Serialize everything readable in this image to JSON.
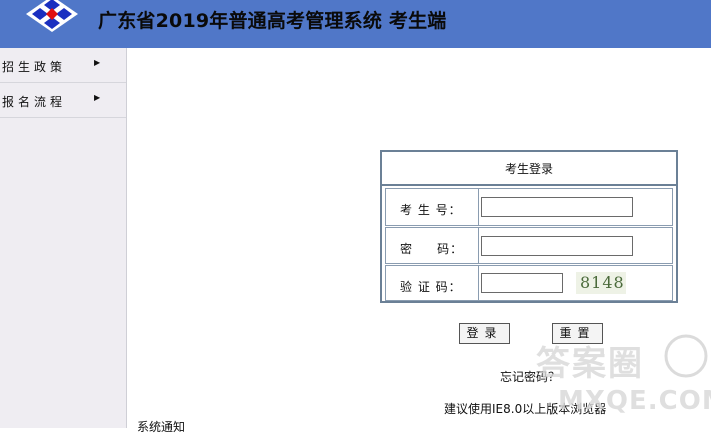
{
  "header": {
    "title": "广东省2019年普通高考管理系统  考生端"
  },
  "sidebar": {
    "items": [
      {
        "label": "招生政策"
      },
      {
        "label": "报名流程"
      }
    ]
  },
  "login": {
    "title": "考生登录",
    "fields": {
      "exam_no_label": "考 生 号：",
      "password_label": "密     码：",
      "captcha_label": "验 证 码："
    },
    "captcha_text": "8148",
    "login_button": "登录",
    "reset_button": "重置"
  },
  "links": {
    "forgot": "忘记密码？",
    "suggest": "建议使用IE8.0以上版本浏览器"
  },
  "bottom": {
    "notice": "系统通知"
  },
  "watermark": {
    "text_cn": "答案圈",
    "text_url": "MXQE.COM"
  }
}
